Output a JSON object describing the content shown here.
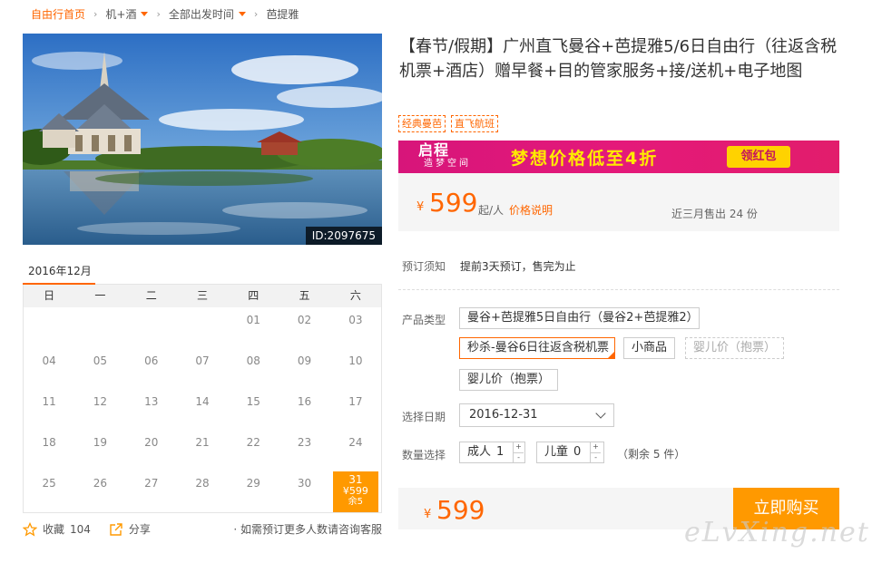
{
  "breadcrumb": {
    "home": "自由行首页",
    "items": [
      "机+酒",
      "全部出发时间",
      "芭提雅"
    ]
  },
  "hero": {
    "product_id": "ID:2097675"
  },
  "calendar": {
    "month": "2016年12月",
    "weekdays": [
      "日",
      "一",
      "二",
      "三",
      "四",
      "五",
      "六"
    ],
    "days": [
      "01",
      "02",
      "03",
      "04",
      "05",
      "06",
      "07",
      "08",
      "09",
      "10",
      "11",
      "12",
      "13",
      "14",
      "15",
      "16",
      "17",
      "18",
      "19",
      "20",
      "21",
      "22",
      "23",
      "24",
      "25",
      "26",
      "27",
      "28",
      "29",
      "30",
      "31"
    ],
    "selected": {
      "day": "31",
      "price": "¥599",
      "left": "余5"
    }
  },
  "actions": {
    "favorite_label": "收藏",
    "favorite_count": "104",
    "share_label": "分享",
    "note": "如需预订更多人数请咨询客服"
  },
  "product": {
    "title": "【春节/假期】广州直飞曼谷+芭提雅5/6日自由行（往返含税机票+酒店）赠早餐+目的管家服务+接/送机+电子地图",
    "tags": [
      "经典曼芭",
      "直飞航班"
    ]
  },
  "banner": {
    "logo": "启程",
    "logo_sub": "造梦空间",
    "slogan": "梦想价格低至4折",
    "button": "领红包"
  },
  "price": {
    "currency": "¥",
    "amount": "599",
    "unit": "起/人",
    "link": "价格说明",
    "sold": "近三月售出 24 份"
  },
  "notice": {
    "label": "预订须知",
    "text": "提前3天预订，售完为止"
  },
  "product_type": {
    "label": "产品类型",
    "options": [
      "曼谷+芭提雅5日自由行（曼谷2+芭提雅2）",
      "秒杀-曼谷6日往返含税机票",
      "小商品",
      "婴儿价（抱票）",
      "婴儿价（抱票）"
    ]
  },
  "date": {
    "label": "选择日期",
    "value": "2016-12-31"
  },
  "quantity": {
    "label": "数量选择",
    "adult_label": "成人",
    "adult_value": "1",
    "child_label": "儿童",
    "child_value": "0",
    "remain": "（剩余 5 件）"
  },
  "buy": {
    "currency": "¥",
    "amount": "599",
    "button": "立即购买"
  },
  "watermark": "eLvXing.net",
  "colors": {
    "accent": "#ff6600",
    "buy_button": "#ff9900",
    "banner": "#e0187a"
  }
}
